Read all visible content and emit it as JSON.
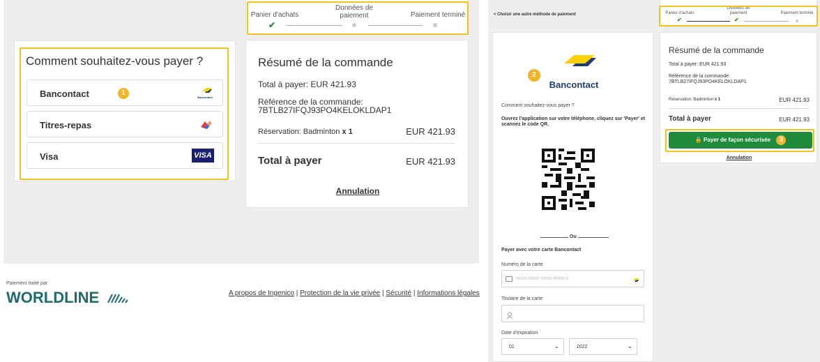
{
  "left": {
    "steps": {
      "step1": "Panier d'achats",
      "step2": "Données de\npaiement",
      "step3": "Paiement terminé"
    },
    "payment_question": "Comment souhaitez-vous payer ?",
    "options": [
      {
        "label": "Bancontact",
        "badge": "1",
        "icon": "bancontact-logo",
        "icon_text": "Bancontact"
      },
      {
        "label": "Titres-repas",
        "icon": "titres-repas-logo"
      },
      {
        "label": "Visa",
        "icon": "visa-logo",
        "icon_text": "VISA"
      }
    ],
    "summary": {
      "title": "Résumé de la commande",
      "total_line": "Total à payer:  EUR 421.93",
      "ref_label": "Référence de la commande:",
      "ref_value": "7BTLB27IFQJ93PO4KELOKLDAP1",
      "reservation_label": "Réservation: Badminton",
      "reservation_qty": "x 1",
      "reservation_amount": "EUR 421.93",
      "total_label": "Total à payer",
      "total_amount": "EUR 421.93",
      "cancel": "Annulation"
    },
    "footer": {
      "processed_by": "Paiement traité par",
      "brand": "WORLDLINE",
      "links": [
        "A propos de Ingenico",
        "Protection de la vie privée",
        "Sécurité",
        "Informations légales"
      ],
      "separator": "|"
    }
  },
  "right": {
    "back_link": "< Choisir une autre méthode de paiement",
    "steps": {
      "step1": "Panier d'achats",
      "step2": "Données de\npaiement",
      "step3": "Paiement terminé"
    },
    "badge2": "2",
    "bancontact_name": "Bancontact",
    "question": "Comment souhaitez-vous payer ?",
    "instructions": "Ouvrez l'application sur votre téléphone, cliquez sur 'Payer' et scannez le code QR.",
    "or": "Ou",
    "card_title": "Payer avec votre carte Bancontact",
    "card_number_label": "Numéro de la carte",
    "card_number_placeholder": "nnnn-nnnn-nnnn-nnnn-n",
    "holder_label": "Titulaire de la carte",
    "expiry_label": "Date d'expiration",
    "expiry_month": "01",
    "expiry_year": "2022",
    "summary": {
      "title": "Résumé de la commande",
      "total_line": "Total à payer:  EUR 421.93",
      "ref_label": "Référence de la commande:",
      "ref_value": "7BTLB27IFQJ93PO4KELOKLDAP1",
      "reservation_label": "Réservation: Badminton",
      "reservation_qty": "x 1",
      "reservation_amount": "EUR 421.93",
      "total_label": "Total à payer",
      "total_amount": "EUR 421.93",
      "pay_button": "Payer de façon sécurisée",
      "badge3": "3",
      "cancel": "Annulation"
    }
  },
  "colors": {
    "highlight": "#f0c419",
    "badge": "#f0b429",
    "green": "#1e8c3a",
    "bancontact_blue": "#1e3c78",
    "bancontact_yellow": "#ffd100"
  }
}
